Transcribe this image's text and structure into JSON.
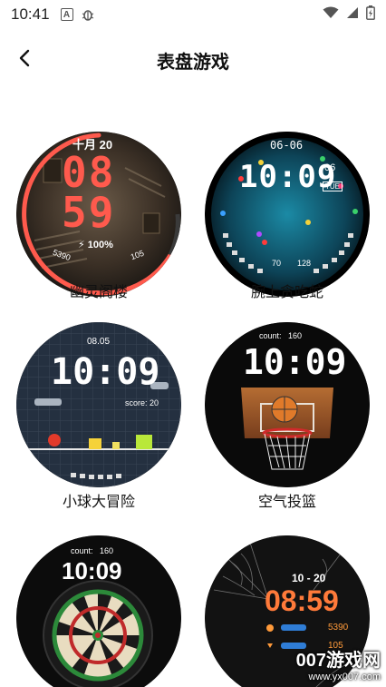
{
  "status_bar": {
    "time": "10:41",
    "icons": [
      "a-badge-icon",
      "bug-icon",
      "wifi-icon",
      "signal-icon",
      "battery-icon"
    ]
  },
  "header": {
    "title": "表盘游戏",
    "back_icon": "chevron-left-icon"
  },
  "watch_faces": [
    {
      "label": "幽灵阁楼",
      "face_texts": {
        "date": "十月 20",
        "hour": "08",
        "minute": "59",
        "battery": "100%",
        "steps": "5390",
        "heart": "105"
      },
      "accent": "#ff5a4d"
    },
    {
      "label": "腕上贪吃蛇",
      "face_texts": {
        "date": "06-06",
        "time": "10:09",
        "seconds": "06",
        "weekday": "TUE",
        "left_num": "70",
        "right_num": "128"
      },
      "accent": "#1a8fa8"
    },
    {
      "label": "小球大冒险",
      "face_texts": {
        "date": "08.05",
        "time": "10:09",
        "score": "score: 20"
      },
      "accent": "#5b6f86"
    },
    {
      "label": "空气投篮",
      "face_texts": {
        "count": "count:",
        "count_value": "160",
        "time": "10:09"
      },
      "accent": "#e07a2a"
    },
    {
      "label": "",
      "face_texts": {
        "count": "count:",
        "count_value": "160",
        "time": "10:09"
      },
      "accent": "#2c8a3a"
    },
    {
      "label": "",
      "face_texts": {
        "date": "10 - 20",
        "time": "08:59",
        "steps": "5390",
        "heart": "105"
      },
      "accent": "#ff7a3a"
    }
  ],
  "watermark": {
    "main": "007游戏网",
    "url": "www.yx007.com"
  }
}
